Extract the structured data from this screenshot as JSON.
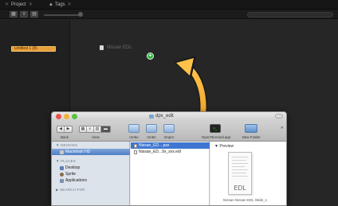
{
  "app": {
    "tabs": [
      {
        "label": "Project"
      },
      {
        "label": "Tags"
      }
    ],
    "timeline_item_label": "Untitled 1 (8)",
    "dragged_file_label": "Nissan EDL"
  },
  "finder": {
    "window_title": "dpx_edit",
    "toolbar": {
      "back_label": "Back",
      "view_label": "View",
      "device_labels": [
        "mntto",
        "mntto",
        "mnpro"
      ],
      "terminal_label": "OpenTerminal.app",
      "new_folder_label": "New Folder"
    },
    "sidebar": {
      "devices_header": "▼ DEVICES",
      "devices": [
        "Macintosh HD"
      ],
      "places_header": "▼ PLACES",
      "places": [
        "Desktop",
        "Sprite",
        "Applications"
      ],
      "search_header": "▶ SEARCH FOR"
    },
    "files": [
      {
        "name": "Nissan_ED....psx"
      },
      {
        "name": "Nissan_ED...9x_sxx.edl"
      }
    ],
    "preview": {
      "title": "▼ Preview",
      "doc_text": "EDL",
      "caption": "Nissan Nissan EDL Wide_s"
    }
  },
  "colors": {
    "timeline_item": "#e8a03a",
    "badge_green": "#27b33b",
    "arrow": "#f2a92b",
    "selection_blue": "#3f76d1"
  }
}
